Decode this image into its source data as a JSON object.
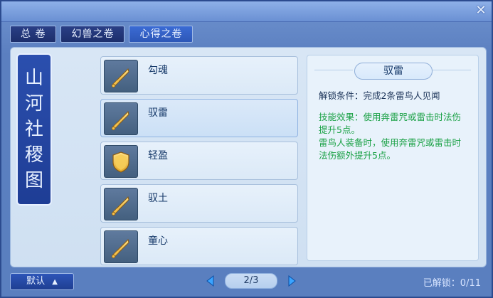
{
  "tabs": [
    "总 卷",
    "幻兽之卷",
    "心得之卷"
  ],
  "banner": {
    "glyphs": [
      "山",
      "河",
      "社",
      "稷",
      "图"
    ]
  },
  "skills": [
    {
      "name": "勾魂",
      "icon": "sword-icon"
    },
    {
      "name": "驭雷",
      "icon": "sword-icon"
    },
    {
      "name": "轻盈",
      "icon": "shield-icon"
    },
    {
      "name": "驭土",
      "icon": "sword-icon"
    },
    {
      "name": "童心",
      "icon": "sword-icon"
    }
  ],
  "detail": {
    "title": "驭雷",
    "unlock_condition": "解锁条件：完成2条雷鸟人见闻",
    "effect_text_1": "技能效果：使用奔雷咒或雷击时法伤提升5点。",
    "effect_text_2": "雷鸟人装备时，使用奔雷咒或雷击时法伤额外提升5点。"
  },
  "footer": {
    "default_label": "默认",
    "default_arrow": "▲",
    "page_indicator": "2/3",
    "unlocked_label": "已解锁：",
    "unlocked_value": "0/11"
  },
  "colors": {
    "window_blue": "#5b7fc0",
    "content_bg": "#d8e6f5",
    "effect_green": "#1aa145"
  }
}
